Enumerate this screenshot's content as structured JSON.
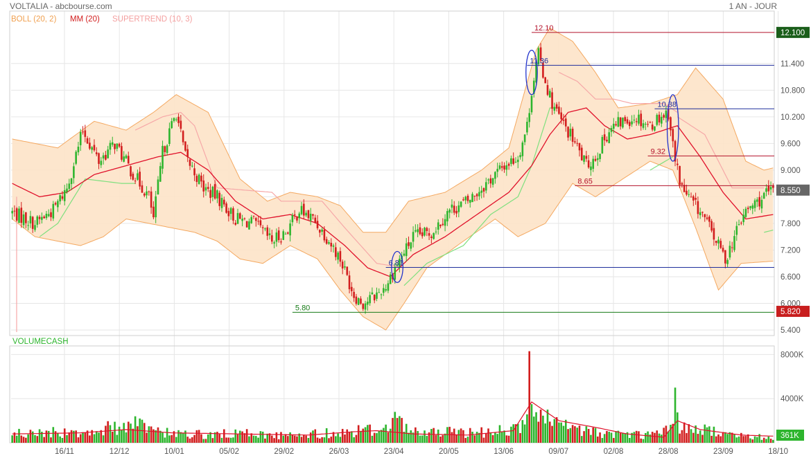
{
  "header": {
    "title": "VOLTALIA - abcbourse.com",
    "period": "1 AN - JOUR"
  },
  "legend": {
    "boll": "BOLL (20, 2)",
    "mm": "MM (20)",
    "supertrend": "SUPERTREND (10, 3)",
    "volume": "VOLUMECASH"
  },
  "colors": {
    "up": "#2db52d",
    "down": "#d21e1e",
    "boll_fill": "#fde3c8",
    "boll_line": "#f4a860",
    "mm": "#e0102a",
    "supertrend_up": "#7ee07e",
    "supertrend_down": "#f6a8a8",
    "resistance": "#b3102a",
    "support_mid": "#1f2e9c",
    "support_low": "#167a16",
    "grid": "#e6e6e6"
  },
  "chart_data": [
    {
      "type": "candlestick",
      "title": "VOLTALIA",
      "period": "1 AN - JOUR",
      "x_tick_labels": [
        "16/11",
        "12/12",
        "10/01",
        "05/02",
        "29/02",
        "26/03",
        "23/04",
        "20/05",
        "13/06",
        "09/07",
        "02/08",
        "28/08",
        "23/09",
        "18/10"
      ],
      "y_ticks": [
        5.4,
        6.0,
        6.6,
        7.2,
        7.8,
        8.4,
        9.0,
        9.6,
        10.2,
        10.8,
        11.4
      ],
      "y_tick_labels": [
        "5.400",
        "6.000",
        "6.600",
        "7.200",
        "7.800",
        "8.400",
        "9.000",
        "9.600",
        "10.200",
        "10.800",
        "11.400"
      ],
      "ylim": [
        5.4,
        12.4
      ],
      "indicators": [
        "BOLL (20, 2)",
        "MM (20)",
        "SUPERTREND (10, 3)"
      ],
      "close_path": [
        [
          0,
          8.05
        ],
        [
          10,
          7.8
        ],
        [
          18,
          8.1
        ],
        [
          24,
          8.6
        ],
        [
          31,
          9.9
        ],
        [
          38,
          9.2
        ],
        [
          45,
          9.6
        ],
        [
          52,
          9.0
        ],
        [
          60,
          8.4
        ],
        [
          62,
          7.9
        ],
        [
          66,
          9.4
        ],
        [
          72,
          10.3
        ],
        [
          76,
          9.3
        ],
        [
          84,
          8.6
        ],
        [
          90,
          8.4
        ],
        [
          98,
          7.9
        ],
        [
          106,
          7.8
        ],
        [
          114,
          7.4
        ],
        [
          120,
          7.6
        ],
        [
          126,
          8.1
        ],
        [
          132,
          7.9
        ],
        [
          138,
          7.5
        ],
        [
          144,
          7.0
        ],
        [
          150,
          6.2
        ],
        [
          154,
          6.0
        ],
        [
          160,
          6.2
        ],
        [
          164,
          6.4
        ],
        [
          168,
          6.8
        ],
        [
          176,
          7.5
        ],
        [
          184,
          7.6
        ],
        [
          192,
          8.1
        ],
        [
          200,
          8.3
        ],
        [
          208,
          8.7
        ],
        [
          216,
          9.1
        ],
        [
          222,
          9.3
        ],
        [
          226,
          10.0
        ],
        [
          228,
          10.8
        ],
        [
          231,
          11.6
        ],
        [
          234,
          11.0
        ],
        [
          237,
          10.5
        ],
        [
          241,
          10.1
        ],
        [
          246,
          9.7
        ],
        [
          252,
          9.1
        ],
        [
          256,
          9.3
        ],
        [
          262,
          9.9
        ],
        [
          268,
          10.1
        ],
        [
          274,
          10.2
        ],
        [
          280,
          10.0
        ],
        [
          284,
          10.2
        ],
        [
          288,
          10.3
        ],
        [
          291,
          9.2
        ],
        [
          294,
          8.6
        ],
        [
          298,
          8.3
        ],
        [
          303,
          8.0
        ],
        [
          308,
          7.5
        ],
        [
          313,
          7.0
        ],
        [
          317,
          7.5
        ],
        [
          321,
          8.0
        ],
        [
          325,
          8.2
        ],
        [
          330,
          8.4
        ],
        [
          334,
          8.55
        ]
      ],
      "bollinger_upper_path": [
        [
          0,
          9.7
        ],
        [
          20,
          9.5
        ],
        [
          36,
          10.1
        ],
        [
          50,
          9.9
        ],
        [
          62,
          10.3
        ],
        [
          72,
          10.7
        ],
        [
          86,
          10.3
        ],
        [
          100,
          8.8
        ],
        [
          112,
          8.3
        ],
        [
          122,
          8.5
        ],
        [
          134,
          8.4
        ],
        [
          144,
          8.2
        ],
        [
          154,
          7.6
        ],
        [
          164,
          7.6
        ],
        [
          174,
          8.3
        ],
        [
          190,
          8.5
        ],
        [
          206,
          9.0
        ],
        [
          218,
          9.5
        ],
        [
          230,
          11.7
        ],
        [
          236,
          12.2
        ],
        [
          246,
          11.9
        ],
        [
          256,
          11.2
        ],
        [
          266,
          10.4
        ],
        [
          280,
          10.5
        ],
        [
          292,
          10.7
        ],
        [
          300,
          11.3
        ],
        [
          312,
          10.6
        ],
        [
          322,
          9.2
        ],
        [
          330,
          9.0
        ],
        [
          334,
          9.05
        ]
      ],
      "bollinger_lower_path": [
        [
          0,
          7.9
        ],
        [
          10,
          7.5
        ],
        [
          20,
          7.4
        ],
        [
          30,
          7.3
        ],
        [
          40,
          7.5
        ],
        [
          50,
          7.9
        ],
        [
          60,
          7.8
        ],
        [
          70,
          7.7
        ],
        [
          80,
          7.6
        ],
        [
          90,
          7.4
        ],
        [
          100,
          7.0
        ],
        [
          110,
          6.9
        ],
        [
          122,
          7.3
        ],
        [
          134,
          7.0
        ],
        [
          144,
          6.3
        ],
        [
          154,
          5.7
        ],
        [
          164,
          5.4
        ],
        [
          172,
          6.0
        ],
        [
          182,
          6.8
        ],
        [
          198,
          7.4
        ],
        [
          212,
          7.9
        ],
        [
          222,
          7.5
        ],
        [
          234,
          7.8
        ],
        [
          246,
          8.7
        ],
        [
          256,
          8.4
        ],
        [
          268,
          8.8
        ],
        [
          280,
          9.2
        ],
        [
          290,
          9.0
        ],
        [
          300,
          7.7
        ],
        [
          310,
          6.3
        ],
        [
          320,
          6.9
        ],
        [
          334,
          6.95
        ]
      ],
      "mm20_path": [
        [
          0,
          8.7
        ],
        [
          12,
          8.4
        ],
        [
          24,
          8.5
        ],
        [
          36,
          8.9
        ],
        [
          50,
          9.1
        ],
        [
          64,
          9.3
        ],
        [
          74,
          9.4
        ],
        [
          86,
          9.0
        ],
        [
          98,
          8.3
        ],
        [
          110,
          7.9
        ],
        [
          122,
          8.0
        ],
        [
          134,
          7.8
        ],
        [
          146,
          7.3
        ],
        [
          156,
          6.8
        ],
        [
          166,
          6.6
        ],
        [
          176,
          7.1
        ],
        [
          190,
          7.5
        ],
        [
          204,
          8.0
        ],
        [
          218,
          8.5
        ],
        [
          228,
          9.1
        ],
        [
          236,
          9.8
        ],
        [
          244,
          10.3
        ],
        [
          252,
          10.4
        ],
        [
          260,
          10.0
        ],
        [
          270,
          9.7
        ],
        [
          280,
          9.8
        ],
        [
          292,
          10.0
        ],
        [
          302,
          9.3
        ],
        [
          312,
          8.5
        ],
        [
          322,
          7.9
        ],
        [
          334,
          8.0
        ]
      ],
      "supertrend_segments": [
        {
          "trend": "up",
          "points": [
            [
              12,
              7.5
            ],
            [
              20,
              7.8
            ],
            [
              32,
              8.8
            ],
            [
              48,
              8.7
            ],
            [
              54,
              8.7
            ]
          ]
        },
        {
          "trend": "down",
          "points": [
            [
              54,
              9.9
            ],
            [
              66,
              10.2
            ],
            [
              74,
              10.3
            ],
            [
              80,
              10.0
            ],
            [
              90,
              8.6
            ],
            [
              114,
              8.5
            ],
            [
              118,
              8.3
            ],
            [
              136,
              8.3
            ],
            [
              146,
              7.7
            ],
            [
              160,
              6.9
            ],
            [
              172,
              6.8
            ]
          ]
        },
        {
          "trend": "up",
          "points": [
            [
              172,
              6.4
            ],
            [
              182,
              6.9
            ],
            [
              198,
              7.3
            ],
            [
              210,
              8.0
            ],
            [
              222,
              8.4
            ],
            [
              228,
              9.1
            ],
            [
              236,
              10.4
            ],
            [
              240,
              10.4
            ]
          ]
        },
        {
          "trend": "down",
          "points": [
            [
              240,
              11.2
            ],
            [
              248,
              11.0
            ],
            [
              256,
              10.6
            ],
            [
              264,
              10.6
            ],
            [
              272,
              10.5
            ],
            [
              286,
              10.5
            ],
            [
              292,
              10.3
            ]
          ]
        },
        {
          "trend": "up",
          "points": [
            [
              280,
              9.0
            ],
            [
              290,
              9.3
            ]
          ]
        },
        {
          "trend": "down",
          "points": [
            [
              292,
              10.2
            ],
            [
              304,
              9.8
            ],
            [
              316,
              8.6
            ],
            [
              330,
              8.6
            ]
          ]
        },
        {
          "trend": "up",
          "points": [
            [
              330,
              7.6
            ],
            [
              334,
              7.65
            ]
          ]
        }
      ],
      "horizontal_levels": [
        {
          "label": "12.10",
          "value": 12.1,
          "kind": "resistance",
          "from": 228
        },
        {
          "label": "11.36",
          "value": 11.36,
          "kind": "support_mid",
          "from": 226
        },
        {
          "label": "10.38",
          "value": 10.38,
          "kind": "support_mid",
          "from": 282
        },
        {
          "label": "9.32",
          "value": 9.32,
          "kind": "resistance",
          "from": 279
        },
        {
          "label": "8.65",
          "value": 8.65,
          "kind": "resistance",
          "from": 247
        },
        {
          "label": "6.81",
          "value": 6.81,
          "kind": "support_mid",
          "from": 164
        },
        {
          "label": "5.80",
          "value": 5.8,
          "kind": "support_low",
          "from": 123
        }
      ],
      "ellipses": [
        {
          "center": [
            228,
            11.2
          ],
          "rx_days": 2.5,
          "ry_value": 0.5
        },
        {
          "center": [
            290,
            9.95
          ],
          "rx_days": 2.5,
          "ry_value": 0.75
        },
        {
          "center": [
            169,
            6.82
          ],
          "rx_days": 2.5,
          "ry_value": 0.35
        }
      ],
      "price_badges": [
        {
          "label": "12.100",
          "value": 12.1,
          "color": "#1a5e1a"
        },
        {
          "label": "8.550",
          "value": 8.55,
          "color": "#666666"
        },
        {
          "label": "5.820",
          "value": 5.82,
          "color": "#c81e1e"
        }
      ]
    },
    {
      "type": "bar",
      "title": "VOLUMECASH",
      "y_ticks": [
        4000,
        8000
      ],
      "y_tick_labels": [
        "4000K",
        "8000K"
      ],
      "ylim": [
        0,
        8400
      ],
      "volume_path": [
        [
          0,
          900
        ],
        [
          20,
          1000
        ],
        [
          40,
          1300
        ],
        [
          54,
          1800
        ],
        [
          60,
          1100
        ],
        [
          80,
          800
        ],
        [
          100,
          900
        ],
        [
          120,
          700
        ],
        [
          140,
          1000
        ],
        [
          160,
          1300
        ],
        [
          168,
          1900
        ],
        [
          176,
          1000
        ],
        [
          200,
          1000
        ],
        [
          220,
          1300
        ],
        [
          226,
          2000
        ],
        [
          228,
          3000
        ],
        [
          240,
          1600
        ],
        [
          260,
          900
        ],
        [
          280,
          800
        ],
        [
          288,
          1200
        ],
        [
          292,
          2000
        ],
        [
          300,
          1400
        ],
        [
          320,
          700
        ],
        [
          334,
          500
        ]
      ],
      "volume_spikes": [
        [
          54,
          2400
        ],
        [
          168,
          2800
        ],
        [
          227,
          8300
        ],
        [
          228,
          3500
        ],
        [
          291,
          5000
        ]
      ],
      "mm_volume_path": [
        [
          0,
          800
        ],
        [
          30,
          900
        ],
        [
          50,
          1200
        ],
        [
          70,
          900
        ],
        [
          100,
          800
        ],
        [
          130,
          700
        ],
        [
          150,
          1000
        ],
        [
          160,
          1100
        ],
        [
          176,
          800
        ],
        [
          200,
          700
        ],
        [
          220,
          1100
        ],
        [
          228,
          3700
        ],
        [
          240,
          2000
        ],
        [
          256,
          1400
        ],
        [
          270,
          800
        ],
        [
          286,
          500
        ],
        [
          292,
          2000
        ],
        [
          302,
          1200
        ],
        [
          320,
          700
        ],
        [
          334,
          600
        ]
      ],
      "last_volume": {
        "label": "361K",
        "value": 361
      }
    }
  ]
}
